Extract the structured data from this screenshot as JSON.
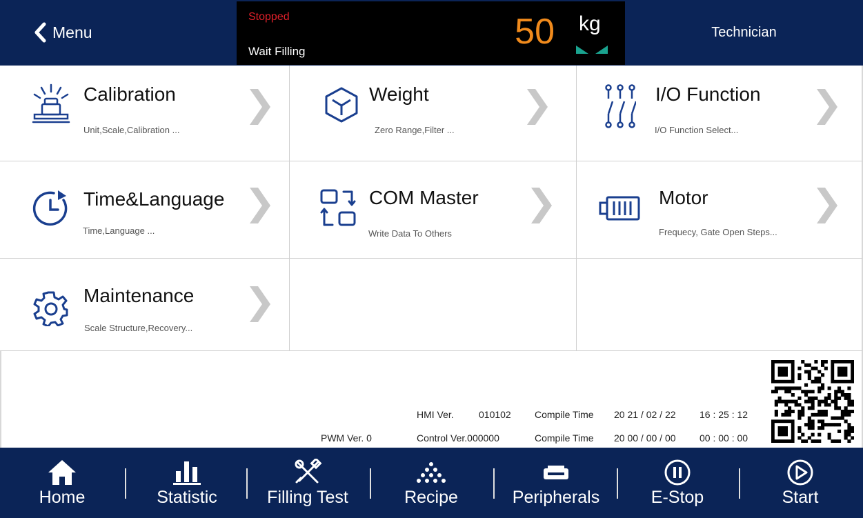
{
  "header": {
    "menu_label": "Menu",
    "status": "Stopped",
    "substatus": "Wait Filling",
    "weight": "50",
    "unit": "kg",
    "user_role": "Technician"
  },
  "tiles": [
    {
      "title": "Calibration",
      "desc": "Unit,Scale,Calibration ..."
    },
    {
      "title": "Weight",
      "desc": "Zero Range,Filter ..."
    },
    {
      "title": "I/O Function",
      "desc": "I/O Function Select..."
    },
    {
      "title": "Time&Language",
      "desc": "Time,Language ..."
    },
    {
      "title": "COM Master",
      "desc": "Write Data To Others"
    },
    {
      "title": "Motor",
      "desc": "Frequecy, Gate Open Steps..."
    },
    {
      "title": "Maintenance",
      "desc": "Scale Structure,Recovery..."
    }
  ],
  "version": {
    "hmi_label": "HMI Ver.",
    "hmi_value": "010102",
    "compile_label": "Compile Time",
    "hmi_compile_date": "20 21 / 02 / 22",
    "hmi_compile_time": "16 : 25 : 12",
    "pwm_label": "PWM Ver. 0",
    "control_label": "Control Ver.000000",
    "control_compile_date": "20  00 / 00 / 00",
    "control_compile_time": "00 : 00 : 00"
  },
  "footer": {
    "items": [
      {
        "label": "Home",
        "icon": "home-icon"
      },
      {
        "label": "Statistic",
        "icon": "bar-chart-icon"
      },
      {
        "label": "Filling Test",
        "icon": "tools-icon"
      },
      {
        "label": "Recipe",
        "icon": "recipe-dots-icon"
      },
      {
        "label": "Peripherals",
        "icon": "printer-icon"
      },
      {
        "label": "E-Stop",
        "icon": "pause-circle-icon"
      },
      {
        "label": "Start",
        "icon": "play-circle-icon"
      }
    ]
  },
  "colors": {
    "header_bg": "#0b2457",
    "accent_blue": "#1a3f8f",
    "weight_orange": "#f08a1c",
    "status_red": "#e0202a",
    "stable_green": "#1aa38f"
  }
}
